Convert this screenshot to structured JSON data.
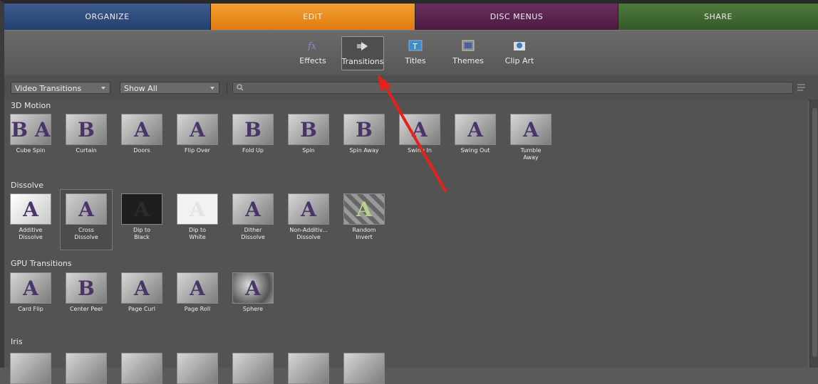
{
  "tabs": [
    "ORGANIZE",
    "EDIT",
    "DISC MENUS",
    "SHARE"
  ],
  "toolbar": {
    "effects": "Effects",
    "transitions": "Transitions",
    "titles": "Titles",
    "themes": "Themes",
    "clipart": "Clip Art"
  },
  "filter": {
    "category": "Video Transitions",
    "show": "Show All",
    "search_placeholder": ""
  },
  "sections": {
    "motion": {
      "title": "3D Motion",
      "items": [
        "Cube Spin",
        "Curtain",
        "Doors",
        "Flip Over",
        "Fold Up",
        "Spin",
        "Spin Away",
        "Swing In",
        "Swing Out",
        "Tumble Away"
      ]
    },
    "dissolve": {
      "title": "Dissolve",
      "items": [
        "Additive Dissolve",
        "Cross Dissolve",
        "Dip to Black",
        "Dip to White",
        "Dither Dissolve",
        "Non-Additiv... Dissolve",
        "Random Invert"
      ]
    },
    "gpu": {
      "title": "GPU Transitions",
      "items": [
        "Card Flip",
        "Center Peel",
        "Page Curl",
        "Page Roll",
        "Sphere"
      ]
    },
    "iris": {
      "title": "Iris"
    }
  },
  "thumb_glyphs": {
    "cube_spin": "B A",
    "letter": "A",
    "letter_b": "B"
  },
  "colors": {
    "edit_tab": "#e07a10",
    "annotation_arrow": "#e8201a"
  }
}
